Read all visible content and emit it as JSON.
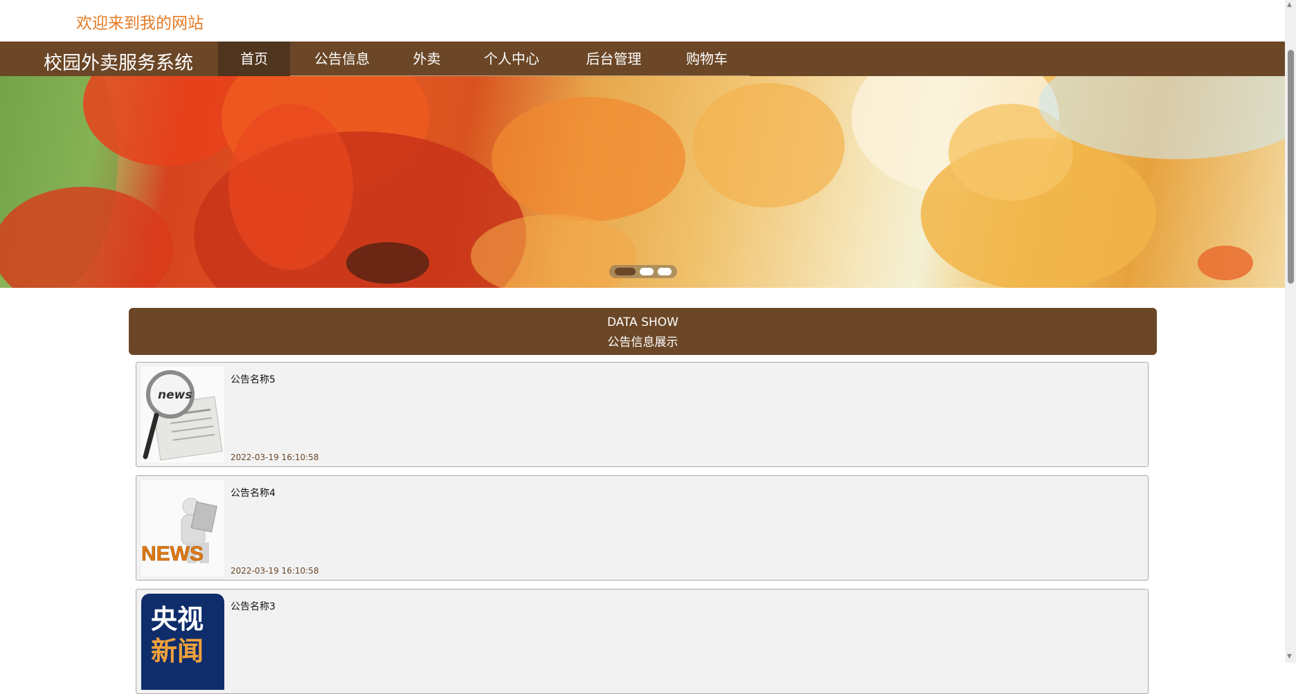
{
  "header": {
    "welcome": "欢迎来到我的网站"
  },
  "nav": {
    "brand": "校园外卖服务系统",
    "items": [
      {
        "label": "首页",
        "active": true
      },
      {
        "label": "公告信息",
        "active": false
      },
      {
        "label": "外卖",
        "active": false
      },
      {
        "label": "个人中心",
        "active": false
      },
      {
        "label": "后台管理",
        "active": false
      },
      {
        "label": "购物车",
        "active": false
      }
    ]
  },
  "banner": {
    "slides": 3,
    "active_slide": 1
  },
  "section": {
    "title_en": "DATA SHOW",
    "title_zh": "公告信息展示"
  },
  "notices": [
    {
      "title": "公告名称5",
      "time": "2022-03-19 16:10:58",
      "thumb": "news-magnifier-image"
    },
    {
      "title": "公告名称4",
      "time": "2022-03-19 16:10:58",
      "thumb": "news-figure-image",
      "thumb_text": "NEWS"
    },
    {
      "title": "公告名称3",
      "time": "",
      "thumb": "cctv-news-image",
      "thumb_text_1": "央视",
      "thumb_text_2": "新闻"
    }
  ],
  "colors": {
    "brand_brown": "#6b4727",
    "active_nav": "#4f341e",
    "welcome_orange": "#e47a25"
  }
}
